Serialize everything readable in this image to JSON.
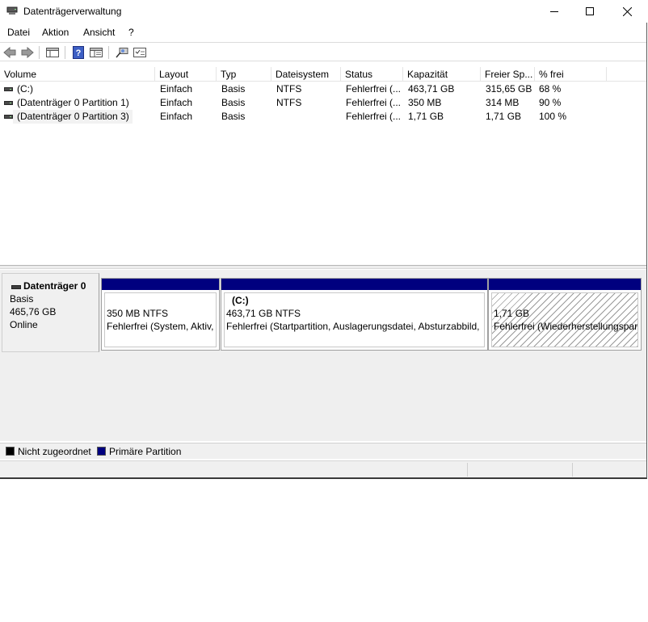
{
  "window": {
    "title": "Datenträgerverwaltung",
    "minimize_icon": "minimize-icon",
    "maximize_icon": "maximize-icon",
    "close_icon": "close-icon"
  },
  "menu": [
    {
      "label": "Datei"
    },
    {
      "label": "Aktion"
    },
    {
      "label": "Ansicht"
    },
    {
      "label": "?"
    }
  ],
  "toolbar": [
    "back-icon",
    "forward-icon",
    "console-tree-icon",
    "help-icon",
    "properties-icon",
    "connect-icon",
    "checklist-icon"
  ],
  "volume_list": {
    "columns": [
      "Volume",
      "Layout",
      "Typ",
      "Dateisystem",
      "Status",
      "Kapazität",
      "Freier Sp...",
      "% frei"
    ],
    "rows": [
      {
        "volume": " (C:)",
        "layout": "Einfach",
        "typ": "Basis",
        "fs": "NTFS",
        "status": "Fehlerfrei (...",
        "capacity": "463,71 GB",
        "free": "315,65 GB",
        "pct": "68 %"
      },
      {
        "volume": "(Datenträger 0 Partition 1)",
        "layout": "Einfach",
        "typ": "Basis",
        "fs": "NTFS",
        "status": "Fehlerfrei (...",
        "capacity": "350 MB",
        "free": "314 MB",
        "pct": "90 %"
      },
      {
        "volume": "(Datenträger 0 Partition 3)",
        "layout": "Einfach",
        "typ": "Basis",
        "fs": "",
        "status": "Fehlerfrei (...",
        "capacity": "1,71 GB",
        "free": "1,71 GB",
        "pct": "100 %"
      }
    ]
  },
  "disk": {
    "name": "Datenträger 0",
    "type": "Basis",
    "size": "465,76 GB",
    "state": "Online",
    "partitions": [
      {
        "title": "",
        "line1": "350 MB NTFS",
        "line2": "Fehlerfrei (System, Aktiv,"
      },
      {
        "title": "(C:)",
        "line1": "463,71 GB NTFS",
        "line2": "Fehlerfrei (Startpartition, Auslagerungsdatei, Absturzabbild,"
      },
      {
        "title": "",
        "line1": "1,71 GB",
        "line2": "Fehlerfrei (Wiederherstellungspar"
      }
    ]
  },
  "legend": [
    {
      "label": "Nicht zugeordnet",
      "color": "#000000"
    },
    {
      "label": "Primäre Partition",
      "color": "#00007f"
    }
  ]
}
